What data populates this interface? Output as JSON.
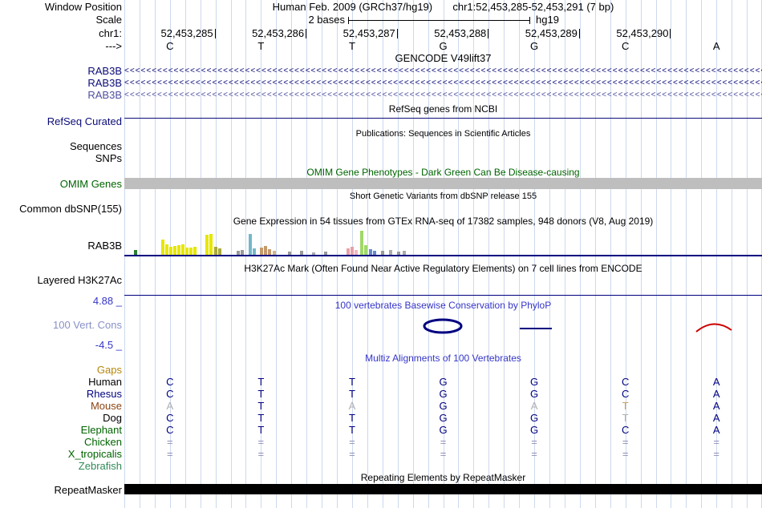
{
  "header": {
    "assembly_line": "Human Feb. 2009 (GRCh37/hg19)",
    "position_line": "chr1:52,453,285-52,453,291 (7 bp)",
    "scale_value": "2 bases",
    "scale_assembly": "hg19",
    "labels": {
      "window_position": "Window Position",
      "scale": "Scale",
      "chrom": "chr1:",
      "direction": "--->"
    },
    "positions": [
      "52,453,285",
      "52,453,286",
      "52,453,287",
      "52,453,288",
      "52,453,289",
      "52,453,290"
    ],
    "ruler_bases": [
      "C",
      "T",
      "T",
      "G",
      "G",
      "C",
      "A"
    ]
  },
  "tracks": {
    "gencode": {
      "title": "GENCODE V49lift37",
      "transcripts": [
        {
          "label": "RAB3B",
          "color": "#0c0c78"
        },
        {
          "label": "RAB3B",
          "color": "#0c0c78"
        },
        {
          "label": "RAB3B",
          "color": "#5050a0"
        }
      ]
    },
    "refseq": {
      "title": "RefSeq genes from NCBI",
      "label": "RefSeq Curated",
      "color": "#0c0c78"
    },
    "publications": {
      "title": "Publications: Sequences in Scientific Articles",
      "row_labels": [
        "Sequences",
        "SNPs"
      ]
    },
    "omim": {
      "title": "OMIM Gene Phenotypes - Dark Green Can Be Disease-causing",
      "label": "OMIM Genes",
      "color": "#006400",
      "bar_color": "#bebebe"
    },
    "dbsnp": {
      "title": "Short Genetic Variants from dbSNP release 155",
      "label": "Common dbSNP(155)"
    },
    "gtex": {
      "title": "Gene Expression in 54 tissues from GTEx RNA-seq of 17382 samples, 948 donors (V8, Aug 2019)",
      "label": "RAB3B",
      "baseline_color": "#000080",
      "bars": [
        [
          12,
          6,
          "#2e7d32"
        ],
        [
          46,
          19,
          "#e6e600"
        ],
        [
          51,
          13,
          "#e6e600"
        ],
        [
          56,
          10,
          "#e6e600"
        ],
        [
          61,
          11,
          "#e6e600"
        ],
        [
          66,
          12,
          "#e6e600"
        ],
        [
          71,
          13,
          "#e6e600"
        ],
        [
          76,
          9,
          "#e6e600"
        ],
        [
          81,
          9,
          "#e6e600"
        ],
        [
          86,
          10,
          "#e6e600"
        ],
        [
          101,
          25,
          "#e6e600"
        ],
        [
          106,
          26,
          "#e6e600"
        ],
        [
          112,
          10,
          "#aaaa3c"
        ],
        [
          117,
          8,
          "#aaaa3c"
        ],
        [
          140,
          5,
          "#999999"
        ],
        [
          145,
          6,
          "#999999"
        ],
        [
          155,
          26,
          "#74b8c8"
        ],
        [
          160,
          8,
          "#74b8c8"
        ],
        [
          169,
          9,
          "#c49a6c"
        ],
        [
          174,
          11,
          "#c49a6c"
        ],
        [
          179,
          7,
          "#c49a6c"
        ],
        [
          185,
          5,
          "#d2b48c"
        ],
        [
          204,
          4,
          "#999999"
        ],
        [
          219,
          5,
          "#999999"
        ],
        [
          234,
          3,
          "#aaaaaa"
        ],
        [
          249,
          4,
          "#999999"
        ],
        [
          277,
          8,
          "#e8a0a8"
        ],
        [
          282,
          10,
          "#e8a0a8"
        ],
        [
          287,
          6,
          "#f0b8c0"
        ],
        [
          294,
          30,
          "#a0d868"
        ],
        [
          299,
          12,
          "#a0d868"
        ],
        [
          305,
          7,
          "#6688cc"
        ],
        [
          310,
          5,
          "#6688cc"
        ],
        [
          320,
          5,
          "#999999"
        ],
        [
          330,
          6,
          "#aaaaaa"
        ],
        [
          340,
          4,
          "#999999"
        ],
        [
          347,
          5,
          "#aaaaaa"
        ]
      ]
    },
    "h3k27ac": {
      "title": "H3K27Ac Mark (Often Found Near Active Regulatory Elements) on 7 cell lines from ENCODE",
      "label": "Layered H3K27Ac",
      "baseline_color": "#000080"
    },
    "phylop": {
      "title": "100 vertebrates Basewise Conservation by PhyloP",
      "label": "100 Vert. Cons",
      "max_label": "4.88 _",
      "min_label": "-4.5 _",
      "title_color": "#3535c8",
      "value_color": "#3535c8",
      "label_color": "#8890c8",
      "glyphs": {
        "center_color": "#000080",
        "mid_color": "#000080",
        "right_color": "#cc0000"
      }
    },
    "multiz": {
      "title": "Multiz Alignments of 100 Vertebrates",
      "title_color": "#3535c8",
      "gaps_label": "Gaps",
      "gaps_color": "#b8860b",
      "species": [
        {
          "name": "Human",
          "name_color": "#000000",
          "bases": [
            "C",
            "T",
            "T",
            "G",
            "G",
            "C",
            "A"
          ],
          "base_colors": [
            "#000080",
            "#000080",
            "#000080",
            "#000080",
            "#000080",
            "#000080",
            "#000080"
          ]
        },
        {
          "name": "Rhesus",
          "name_color": "#000080",
          "bases": [
            "C",
            "T",
            "T",
            "G",
            "G",
            "C",
            "A"
          ],
          "base_colors": [
            "#000080",
            "#000080",
            "#000080",
            "#000080",
            "#000080",
            "#000080",
            "#000080"
          ]
        },
        {
          "name": "Mouse",
          "name_color": "#8b4513",
          "bases": [
            "A",
            "T",
            "A",
            "G",
            "A",
            "T",
            "A"
          ],
          "base_colors": [
            "#b0b0b0",
            "#000080",
            "#b0b0b0",
            "#000080",
            "#b0b0b0",
            "#c8a165",
            "#000080"
          ]
        },
        {
          "name": "Dog",
          "name_color": "#000000",
          "bases": [
            "C",
            "T",
            "T",
            "G",
            "G",
            "T",
            "A"
          ],
          "base_colors": [
            "#000080",
            "#000080",
            "#000080",
            "#000080",
            "#000080",
            "#b0b0b0",
            "#000080"
          ]
        },
        {
          "name": "Elephant",
          "name_color": "#006400",
          "bases": [
            "C",
            "T",
            "T",
            "G",
            "G",
            "C",
            "A"
          ],
          "base_colors": [
            "#000080",
            "#000080",
            "#000080",
            "#000080",
            "#000080",
            "#000080",
            "#000080"
          ]
        },
        {
          "name": "Chicken",
          "name_color": "#006400",
          "bases": [
            "=",
            "=",
            "=",
            "=",
            "=",
            "=",
            "="
          ],
          "base_colors": [
            "#9090b8",
            "#9090b8",
            "#9090b8",
            "#9090b8",
            "#9090b8",
            "#9090b8",
            "#9090b8"
          ]
        },
        {
          "name": "X_tropicalis",
          "name_color": "#006400",
          "bases": [
            "=",
            "=",
            "=",
            "=",
            "=",
            "=",
            "="
          ],
          "base_colors": [
            "#9090b8",
            "#9090b8",
            "#9090b8",
            "#9090b8",
            "#9090b8",
            "#9090b8",
            "#9090b8"
          ]
        },
        {
          "name": "Zebrafish",
          "name_color": "#2e8b57",
          "bases": [
            "",
            "",
            "",
            "",
            "",
            "",
            ""
          ],
          "base_colors": [
            "",
            "",
            "",
            "",
            "",
            "",
            ""
          ]
        }
      ]
    },
    "repeatmasker": {
      "title": "Repeating Elements by RepeatMasker",
      "label": "RepeatMasker",
      "bar_color": "#000000"
    }
  },
  "layout_colors": {
    "guideline": "#ccd9ec",
    "ruler": "#000000"
  }
}
